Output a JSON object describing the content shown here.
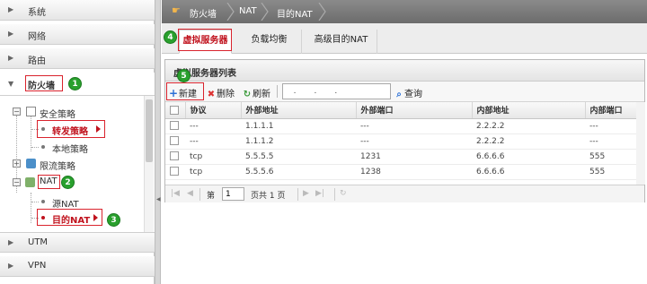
{
  "nav": {
    "sections": [
      {
        "label": "系统"
      },
      {
        "label": "网络"
      },
      {
        "label": "路由"
      },
      {
        "label": "防火墙"
      },
      {
        "label": "UTM"
      },
      {
        "label": "VPN"
      }
    ],
    "tree": {
      "security_policy": "安全策略",
      "forward_policy": "转发策略",
      "local_policy": "本地策略",
      "rate_limit_policy": "限流策略",
      "nat": "NAT",
      "source_nat": "源NAT",
      "dest_nat": "目的NAT"
    },
    "icons": {
      "expand": "triangle-right",
      "collapse": "triangle-down"
    }
  },
  "badges": [
    "1",
    "2",
    "3",
    "4",
    "5"
  ],
  "breadcrumb": {
    "items": [
      "防火墙",
      "NAT",
      "目的NAT"
    ],
    "icon": "home-hand-icon"
  },
  "tabs": [
    {
      "label": "虚拟服务器",
      "active": true
    },
    {
      "label": "负载均衡",
      "active": false
    },
    {
      "label": "高级目的NAT",
      "active": false
    }
  ],
  "list": {
    "title": "虚拟服务器列表",
    "toolbar": {
      "new": "新建",
      "delete": "删除",
      "refresh": "刷新",
      "search_value": "   .       .       .",
      "search_button": "查询"
    },
    "columns": [
      "协议",
      "外部地址",
      "外部端口",
      "内部地址",
      "内部端口"
    ],
    "rows": [
      [
        "---",
        "1.1.1.1",
        "---",
        "2.2.2.2",
        "---"
      ],
      [
        "---",
        "1.1.1.2",
        "---",
        "2.2.2.2",
        "---"
      ],
      [
        "tcp",
        "5.5.5.5",
        "1231",
        "6.6.6.6",
        "555"
      ],
      [
        "tcp",
        "5.5.5.6",
        "1238",
        "6.6.6.6",
        "555"
      ]
    ],
    "pager": {
      "page_prefix": "第",
      "page_value": "1",
      "page_suffix": "页共 1 页"
    }
  },
  "colors": {
    "highlight_red": "#d9232d",
    "badge_green": "#29a02d",
    "breadcrumb_bg": "#777777"
  }
}
